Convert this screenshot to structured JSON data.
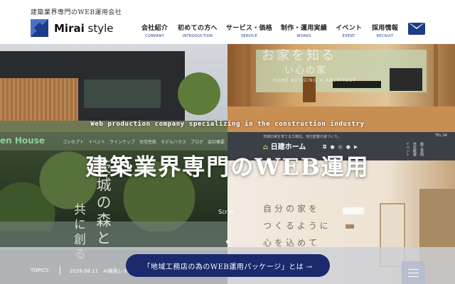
{
  "header": {
    "tagline": "建築業界専門のWEB運用会社",
    "logo_bold": "Mirai",
    "logo_rest": " style",
    "nav": [
      {
        "ja": "会社紹介",
        "en": "COMPANY"
      },
      {
        "ja": "初めての方へ",
        "en": "INTRODUCTION"
      },
      {
        "ja": "サービス・価格",
        "en": "SERVICE"
      },
      {
        "ja": "制作・運用実績",
        "en": "WORKS"
      },
      {
        "ja": "イベント",
        "en": "EVENT"
      },
      {
        "ja": "採用情報",
        "en": "RECRUIT"
      }
    ],
    "mail_icon": "mail-icon",
    "brand_color": "#1d3c88"
  },
  "hero": {
    "subtitle": "Web production company specializing in the construction industry",
    "title": "建築業界専門のWEB運用",
    "scroll_label": "Scroll",
    "tile_top_right": {
      "line1": "お家を知る",
      "line2": "い心の家",
      "line3": "HOME BUILDING × ARCHITECT"
    },
    "tile_bottom_left": {
      "brand": "en House",
      "nav": "コンセプト　イベント　ラインナップ　住宅性能　モデルハウス　ブログ　会社概要",
      "vertical1": "茨城の森と",
      "vertical2": "共に創る"
    },
    "tile_bottom_right": {
      "topline": "茨城の家を育てる工務店。地元密着の家づくり。",
      "logo": "日建ホーム",
      "tel": "TEL.04",
      "vnav": "施工事例 会社概要 イベント",
      "copy1": "自分の家を",
      "copy2": "つくるように",
      "copy3": "心を込めて",
      "social_icons": "instagram-icon facebook-icon twitter-icon pinterest-icon youtube-icon"
    }
  },
  "topics": {
    "label": "TOPICS",
    "date": "2026.08.11　AI検索レポ"
  },
  "cta": {
    "label": "「地域工務店の為のWEB運用パッケージ」とは →"
  },
  "menu_icon": "hamburger-menu-icon"
}
